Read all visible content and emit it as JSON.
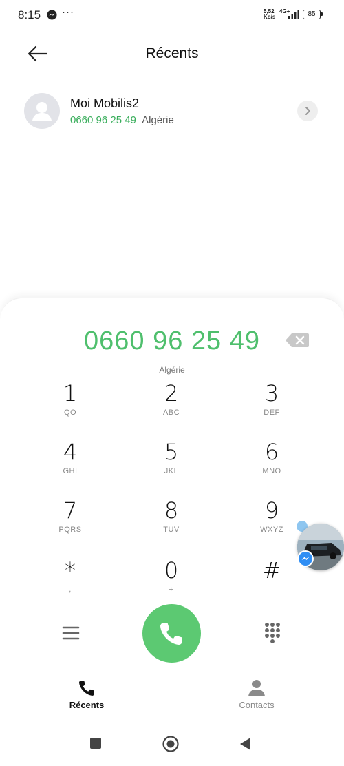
{
  "status_bar": {
    "time": "8:15",
    "more": "···",
    "net_speed_value": "5,52",
    "net_speed_unit": "Ko/s",
    "network_type": "4G+",
    "battery": "85"
  },
  "header": {
    "title": "Récents"
  },
  "recents": [
    {
      "name": "Moi Mobilis2",
      "number": "0660 96 25 49",
      "country": "Algérie"
    }
  ],
  "dialer": {
    "number": "0660 96 25 49",
    "country": "Algérie",
    "keys": [
      {
        "digit": "1",
        "letters": "QO"
      },
      {
        "digit": "2",
        "letters": "ABC"
      },
      {
        "digit": "3",
        "letters": "DEF"
      },
      {
        "digit": "4",
        "letters": "GHI"
      },
      {
        "digit": "5",
        "letters": "JKL"
      },
      {
        "digit": "6",
        "letters": "MNO"
      },
      {
        "digit": "7",
        "letters": "PQRS"
      },
      {
        "digit": "8",
        "letters": "TUV"
      },
      {
        "digit": "9",
        "letters": "WXYZ"
      },
      {
        "digit": "*",
        "letters": ","
      },
      {
        "digit": "0",
        "letters": "+"
      },
      {
        "digit": "#",
        "letters": ""
      }
    ]
  },
  "tabs": [
    {
      "label": "Récents",
      "active": true
    },
    {
      "label": "Contacts",
      "active": false
    }
  ],
  "colors": {
    "accent_green": "#4fbf6d",
    "call_button": "#5cc972",
    "secondary_text": "#888888"
  },
  "icons": [
    "messenger-icon",
    "back-arrow-icon",
    "person-icon",
    "chevron-right-icon",
    "backspace-icon",
    "menu-icon",
    "phone-icon",
    "dialpad-icon",
    "contacts-icon"
  ]
}
